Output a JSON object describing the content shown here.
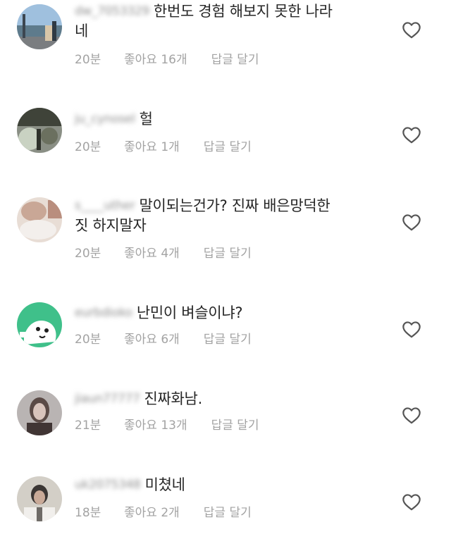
{
  "icons": {
    "like": "heart-outline-icon"
  },
  "comments": [
    {
      "username": "dw_7053329",
      "text": "한번도 경험 해보지 못한 나라네",
      "line1": "한번도 경험 해보지 못한 나라",
      "line2": "네",
      "time": "20분",
      "likes": "좋아요 16개",
      "reply": "답글 달기"
    },
    {
      "username": "ju_cynosel",
      "text": "헐",
      "line1": "헐",
      "time": "20분",
      "likes": "좋아요 1개",
      "reply": "답글 달기"
    },
    {
      "username": "s____uther",
      "text": "말이되는건가? 진짜 배은망덕한 짓 하지말자",
      "line1": "말이되는건가? 진짜 배은망덕한",
      "line2": "짓 하지말자",
      "time": "20분",
      "likes": "좋아요 4개",
      "reply": "답글 달기"
    },
    {
      "username": "eurbdioko",
      "text": "난민이 벼슬이냐?",
      "line1": "난민이 벼슬이냐?",
      "time": "20분",
      "likes": "좋아요 6개",
      "reply": "답글 달기"
    },
    {
      "username": "jiaun77777",
      "text": "진짜화남.",
      "line1": "진짜화남.",
      "time": "21분",
      "likes": "좋아요 13개",
      "reply": "답글 달기"
    },
    {
      "username": "uk2075348",
      "text": "미쳤네",
      "line1": "미쳤네",
      "time": "18분",
      "likes": "좋아요 2개",
      "reply": "답글 달기"
    }
  ]
}
